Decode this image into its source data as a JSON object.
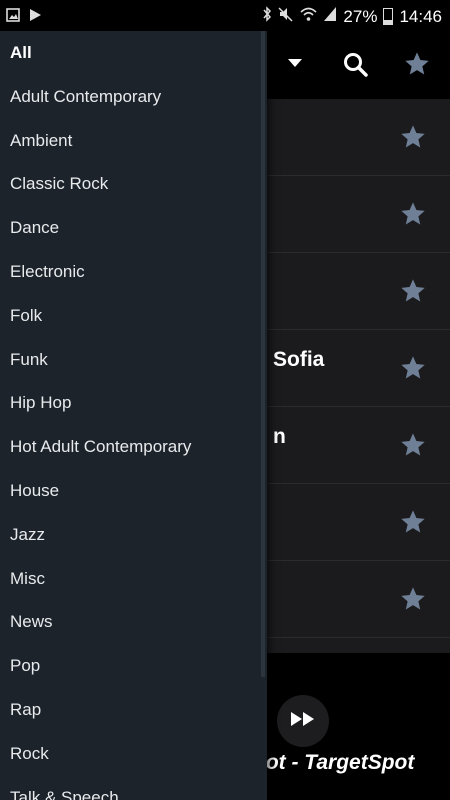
{
  "status_bar": {
    "battery": "27%",
    "time": "14:46",
    "battery_level": 0.27,
    "left_icons": [
      "gallery-icon",
      "play-icon"
    ],
    "right_icons": [
      "bluetooth-icon",
      "mute-icon",
      "wifi-icon",
      "signal-icon",
      "battery-icon"
    ]
  },
  "toolbar": {
    "icons": [
      "dropdown-icon",
      "search-icon",
      "favorites-star-icon"
    ]
  },
  "stations": [
    {
      "name": ""
    },
    {
      "name": ""
    },
    {
      "name": ""
    },
    {
      "name": "Sofia"
    },
    {
      "name": "n"
    },
    {
      "name": ""
    },
    {
      "name": ""
    }
  ],
  "player": {
    "now_playing": "pot - TargetSpot",
    "button_icon": "fast-forward-icon"
  },
  "drawer": {
    "genres": [
      {
        "label": "All",
        "active": true
      },
      {
        "label": "Adult Contemporary"
      },
      {
        "label": "Ambient"
      },
      {
        "label": "Classic Rock"
      },
      {
        "label": "Dance"
      },
      {
        "label": "Electronic"
      },
      {
        "label": "Folk"
      },
      {
        "label": "Funk"
      },
      {
        "label": "Hip Hop"
      },
      {
        "label": "Hot Adult Contemporary"
      },
      {
        "label": "House"
      },
      {
        "label": "Jazz"
      },
      {
        "label": "Misc"
      },
      {
        "label": "News"
      },
      {
        "label": "Pop"
      },
      {
        "label": "Rap"
      },
      {
        "label": "Rock"
      },
      {
        "label": "Talk & Speech"
      }
    ]
  },
  "colors": {
    "drawer_bg": "#1c232b",
    "star": "#6f7f96",
    "main_bg": "#1b1b1d"
  }
}
